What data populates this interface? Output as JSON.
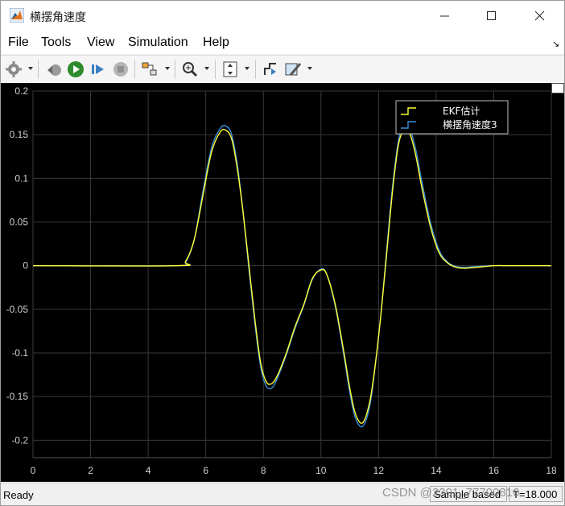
{
  "window": {
    "title": "横摆角速度"
  },
  "menu": [
    {
      "label": "File",
      "mnemonic": "F"
    },
    {
      "label": "Tools",
      "mnemonic": "T"
    },
    {
      "label": "View",
      "mnemonic": "V"
    },
    {
      "label": "Simulation",
      "mnemonic": "i"
    },
    {
      "label": "Help",
      "mnemonic": "H"
    }
  ],
  "toolbar": {
    "buttons": [
      "settings-icon",
      "step-back-icon",
      "run-icon",
      "step-forward-icon",
      "stop-icon",
      "highlight-block-icon",
      "zoom-icon",
      "fit-view-icon",
      "cursor-measure-icon",
      "style-icon"
    ]
  },
  "status": {
    "ready": "Ready",
    "mode": "Sample based",
    "time": "T=18.000"
  },
  "watermark": "CSDN @2301_77700816",
  "colors": {
    "plot_background": "#000000",
    "grid": "#3a3a3a",
    "axis_text": "#d0d0d0",
    "series_ekf": "#ffff33",
    "series_yaw": "#3b8fd9"
  },
  "chart_data": {
    "type": "line",
    "title": "",
    "xlabel": "",
    "ylabel": "",
    "xlim": [
      0,
      18
    ],
    "ylim": [
      -0.22,
      0.2
    ],
    "x_ticks": [
      "0",
      "2",
      "4",
      "6",
      "8",
      "10",
      "12",
      "14",
      "16",
      "18"
    ],
    "y_ticks": [
      "0.2",
      "0.15",
      "0.1",
      "0.05",
      "0",
      "-0.05",
      "-0.1",
      "-0.15",
      "-0.2"
    ],
    "grid": true,
    "legend_position": "top-right",
    "series": [
      {
        "name": "EKF估计",
        "color": "#ffff33",
        "x": [
          0,
          5.0,
          5.3,
          5.6,
          5.9,
          6.2,
          6.5,
          6.7,
          6.9,
          7.1,
          7.3,
          7.5,
          7.7,
          7.9,
          8.1,
          8.3,
          8.5,
          8.8,
          9.1,
          9.4,
          9.7,
          10.0,
          10.2,
          10.5,
          10.8,
          11.0,
          11.2,
          11.45,
          11.7,
          11.9,
          12.1,
          12.3,
          12.5,
          12.7,
          12.9,
          13.1,
          13.3,
          13.5,
          13.8,
          14.1,
          14.4,
          14.7,
          15.0,
          15.4,
          16.0,
          16.5,
          18
        ],
        "y": [
          0,
          0,
          0.005,
          0.03,
          0.08,
          0.13,
          0.153,
          0.155,
          0.145,
          0.11,
          0.06,
          0.0,
          -0.06,
          -0.11,
          -0.133,
          -0.135,
          -0.125,
          -0.1,
          -0.07,
          -0.045,
          -0.015,
          -0.005,
          -0.01,
          -0.045,
          -0.1,
          -0.14,
          -0.17,
          -0.18,
          -0.155,
          -0.11,
          -0.05,
          0.02,
          0.09,
          0.14,
          0.155,
          0.15,
          0.125,
          0.09,
          0.045,
          0.015,
          0.003,
          -0.002,
          -0.003,
          -0.002,
          0,
          0,
          0
        ]
      },
      {
        "name": "横摆角速度3",
        "color": "#3b8fd9",
        "x": [
          0,
          5.0,
          5.3,
          5.6,
          5.9,
          6.2,
          6.5,
          6.7,
          6.9,
          7.1,
          7.3,
          7.5,
          7.7,
          7.9,
          8.1,
          8.3,
          8.5,
          8.8,
          9.1,
          9.4,
          9.7,
          10.0,
          10.2,
          10.5,
          10.8,
          11.0,
          11.2,
          11.45,
          11.7,
          11.9,
          12.1,
          12.3,
          12.5,
          12.7,
          12.9,
          13.1,
          13.3,
          13.5,
          13.8,
          14.1,
          14.4,
          14.7,
          15.0,
          15.4,
          16.0,
          16.5,
          18
        ],
        "y": [
          0,
          0,
          0.004,
          0.03,
          0.085,
          0.135,
          0.157,
          0.16,
          0.15,
          0.115,
          0.06,
          -0.005,
          -0.065,
          -0.115,
          -0.138,
          -0.14,
          -0.128,
          -0.102,
          -0.072,
          -0.046,
          -0.016,
          -0.004,
          -0.01,
          -0.047,
          -0.104,
          -0.145,
          -0.175,
          -0.184,
          -0.16,
          -0.11,
          -0.05,
          0.025,
          0.095,
          0.145,
          0.16,
          0.155,
          0.132,
          0.097,
          0.05,
          0.018,
          0.004,
          -0.001,
          -0.002,
          -0.001,
          0,
          0,
          0
        ]
      }
    ]
  }
}
